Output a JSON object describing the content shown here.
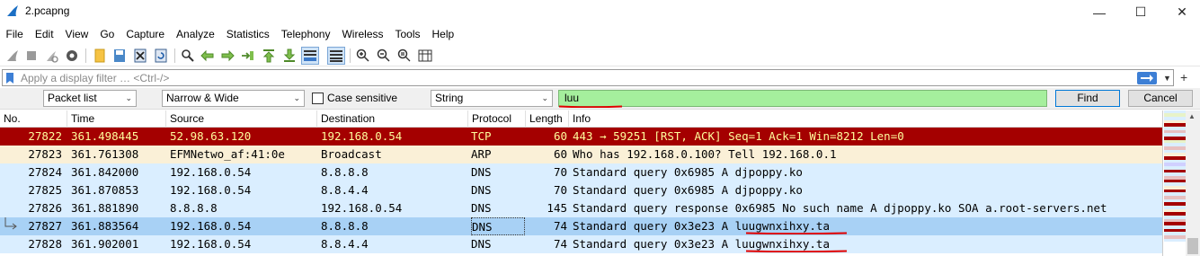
{
  "window": {
    "title": "2.pcapng",
    "minimize_glyph": "—",
    "maximize_glyph": "☐",
    "close_glyph": "✕"
  },
  "menu": [
    "File",
    "Edit",
    "View",
    "Go",
    "Capture",
    "Analyze",
    "Statistics",
    "Telephony",
    "Wireless",
    "Tools",
    "Help"
  ],
  "filter": {
    "placeholder": "Apply a display filter … <Ctrl-/>"
  },
  "find": {
    "search_in": "Packet list",
    "char_width": "Narrow & Wide",
    "case_sensitive_label": "Case sensitive",
    "case_sensitive_checked": false,
    "search_type": "String",
    "query": "luu",
    "find_label": "Find",
    "cancel_label": "Cancel"
  },
  "packets": {
    "columns": [
      "No.",
      "Time",
      "Source",
      "Destination",
      "Protocol",
      "Length",
      "Info"
    ],
    "rows": [
      {
        "no": "27822",
        "time": "361.498445",
        "src": "52.98.63.120",
        "dst": "192.168.0.54",
        "proto": "TCP",
        "len": "60",
        "info": "443 → 59251 [RST, ACK] Seq=1 Ack=1 Win=8212 Len=0",
        "style": "bad-tcp"
      },
      {
        "no": "27823",
        "time": "361.761308",
        "src": "EFMNetwo_af:41:0e",
        "dst": "Broadcast",
        "proto": "ARP",
        "len": "60",
        "info": "Who has 192.168.0.100? Tell 192.168.0.1",
        "style": "arp"
      },
      {
        "no": "27824",
        "time": "361.842000",
        "src": "192.168.0.54",
        "dst": "8.8.8.8",
        "proto": "DNS",
        "len": "70",
        "info": "Standard query 0x6985 A djpoppy.ko",
        "style": "dns"
      },
      {
        "no": "27825",
        "time": "361.870853",
        "src": "192.168.0.54",
        "dst": "8.8.4.4",
        "proto": "DNS",
        "len": "70",
        "info": "Standard query 0x6985 A djpoppy.ko",
        "style": "dns"
      },
      {
        "no": "27826",
        "time": "361.881890",
        "src": "8.8.8.8",
        "dst": "192.168.0.54",
        "proto": "DNS",
        "len": "145",
        "info": "Standard query response 0x6985 No such name A djpoppy.ko SOA a.root-servers.net",
        "style": "dns"
      },
      {
        "no": "27827",
        "time": "361.883564",
        "src": "192.168.0.54",
        "dst": "8.8.8.8",
        "proto": "DNS",
        "len": "74",
        "info": "Standard query 0x3e23 A luugwnxihxy.ta",
        "style": "selected"
      },
      {
        "no": "27828",
        "time": "361.902001",
        "src": "192.168.0.54",
        "dst": "8.8.4.4",
        "proto": "DNS",
        "len": "74",
        "info": "Standard query 0x3e23 A luugwnxihxy.ta",
        "style": "dns"
      }
    ]
  },
  "colors": {
    "bad_tcp_bg": "#a40000",
    "bad_tcp_fg": "#fffc9c",
    "arp_bg": "#faf0d7",
    "dns_bg": "#daeeff",
    "selected_bg": "#a8d1f5",
    "find_match_bg": "#a5ef9d",
    "annotation_red": "#e00000"
  },
  "icons": [
    "shark-fin-start-icon",
    "stop-icon",
    "restart-icon",
    "options-gear-icon",
    "open-file-icon",
    "save-file-icon",
    "close-file-icon",
    "reload-icon",
    "find-packet-icon",
    "go-back-icon",
    "go-forward-icon",
    "go-to-packet-icon",
    "go-first-icon",
    "go-last-icon",
    "autoscroll-icon",
    "colorize-icon",
    "zoom-in-icon",
    "zoom-out-icon",
    "zoom-normal-icon",
    "resize-columns-icon"
  ]
}
